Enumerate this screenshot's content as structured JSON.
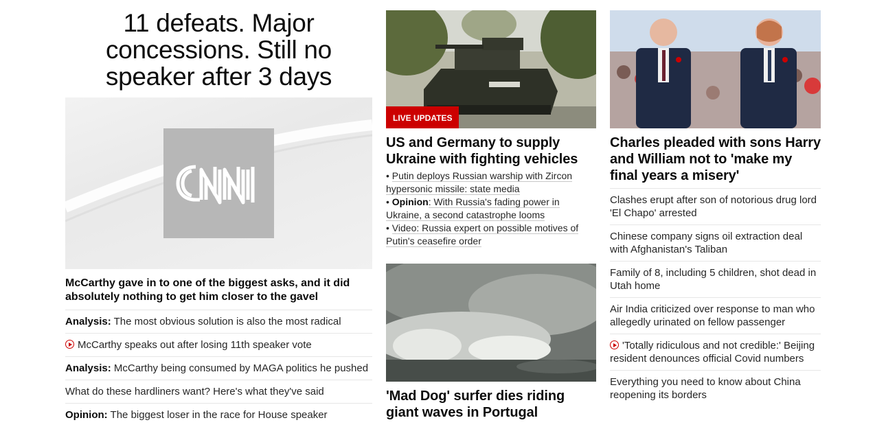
{
  "col1": {
    "headline": "11 defeats. Major concessions. Still no speaker after 3 days",
    "image_icon": "cnn-logo-icon",
    "lead": "McCarthy gave in to one of the biggest asks, and it did absolutely nothing to get him closer to the gavel",
    "items": [
      {
        "prefix": "Analysis:",
        "text": " The most obvious solution is also the most radical"
      },
      {
        "icon": "play-icon",
        "text": "McCarthy speaks out after losing 11th speaker vote"
      },
      {
        "prefix": "Analysis:",
        "text": " McCarthy being consumed by MAGA politics he pushed"
      },
      {
        "text": "What do these hardliners want? Here's what they've said"
      },
      {
        "prefix": "Opinion:",
        "text": " The biggest loser in the race for House speaker"
      }
    ]
  },
  "col2": {
    "badge": "LIVE UPDATES",
    "headline": "US and Germany to supply Ukraine with fighting vehicles",
    "bullets": [
      {
        "text": "Putin deploys Russian warship with Zircon hypersonic missile: state media"
      },
      {
        "prefix": "Opinion",
        "text": ": With Russia's fading power in Ukraine, a second catastrophe looms"
      },
      {
        "text": "Video: Russia expert on possible motives of Putin's ceasefire order"
      }
    ],
    "headline2": "'Mad Dog' surfer dies riding giant waves in Portugal"
  },
  "col3": {
    "headline": "Charles pleaded with sons Harry and William not to 'make my final years a misery'",
    "items": [
      {
        "text": "Clashes erupt after son of notorious drug lord 'El Chapo' arrested"
      },
      {
        "text": "Chinese company signs oil extraction deal with Afghanistan's Taliban"
      },
      {
        "text": "Family of 8, including 5 children, shot dead in Utah home"
      },
      {
        "text": "Air India criticized over response to man who allegedly urinated on fellow passenger"
      },
      {
        "icon": "play-icon",
        "text": "'Totally ridiculous and not credible:' Beijing resident denounces official Covid numbers"
      },
      {
        "text": "Everything you need to know about China reopening its borders"
      }
    ]
  },
  "colors": {
    "accent": "#cc0000",
    "text": "#0c0c0c",
    "divider": "#e6e6e6"
  }
}
